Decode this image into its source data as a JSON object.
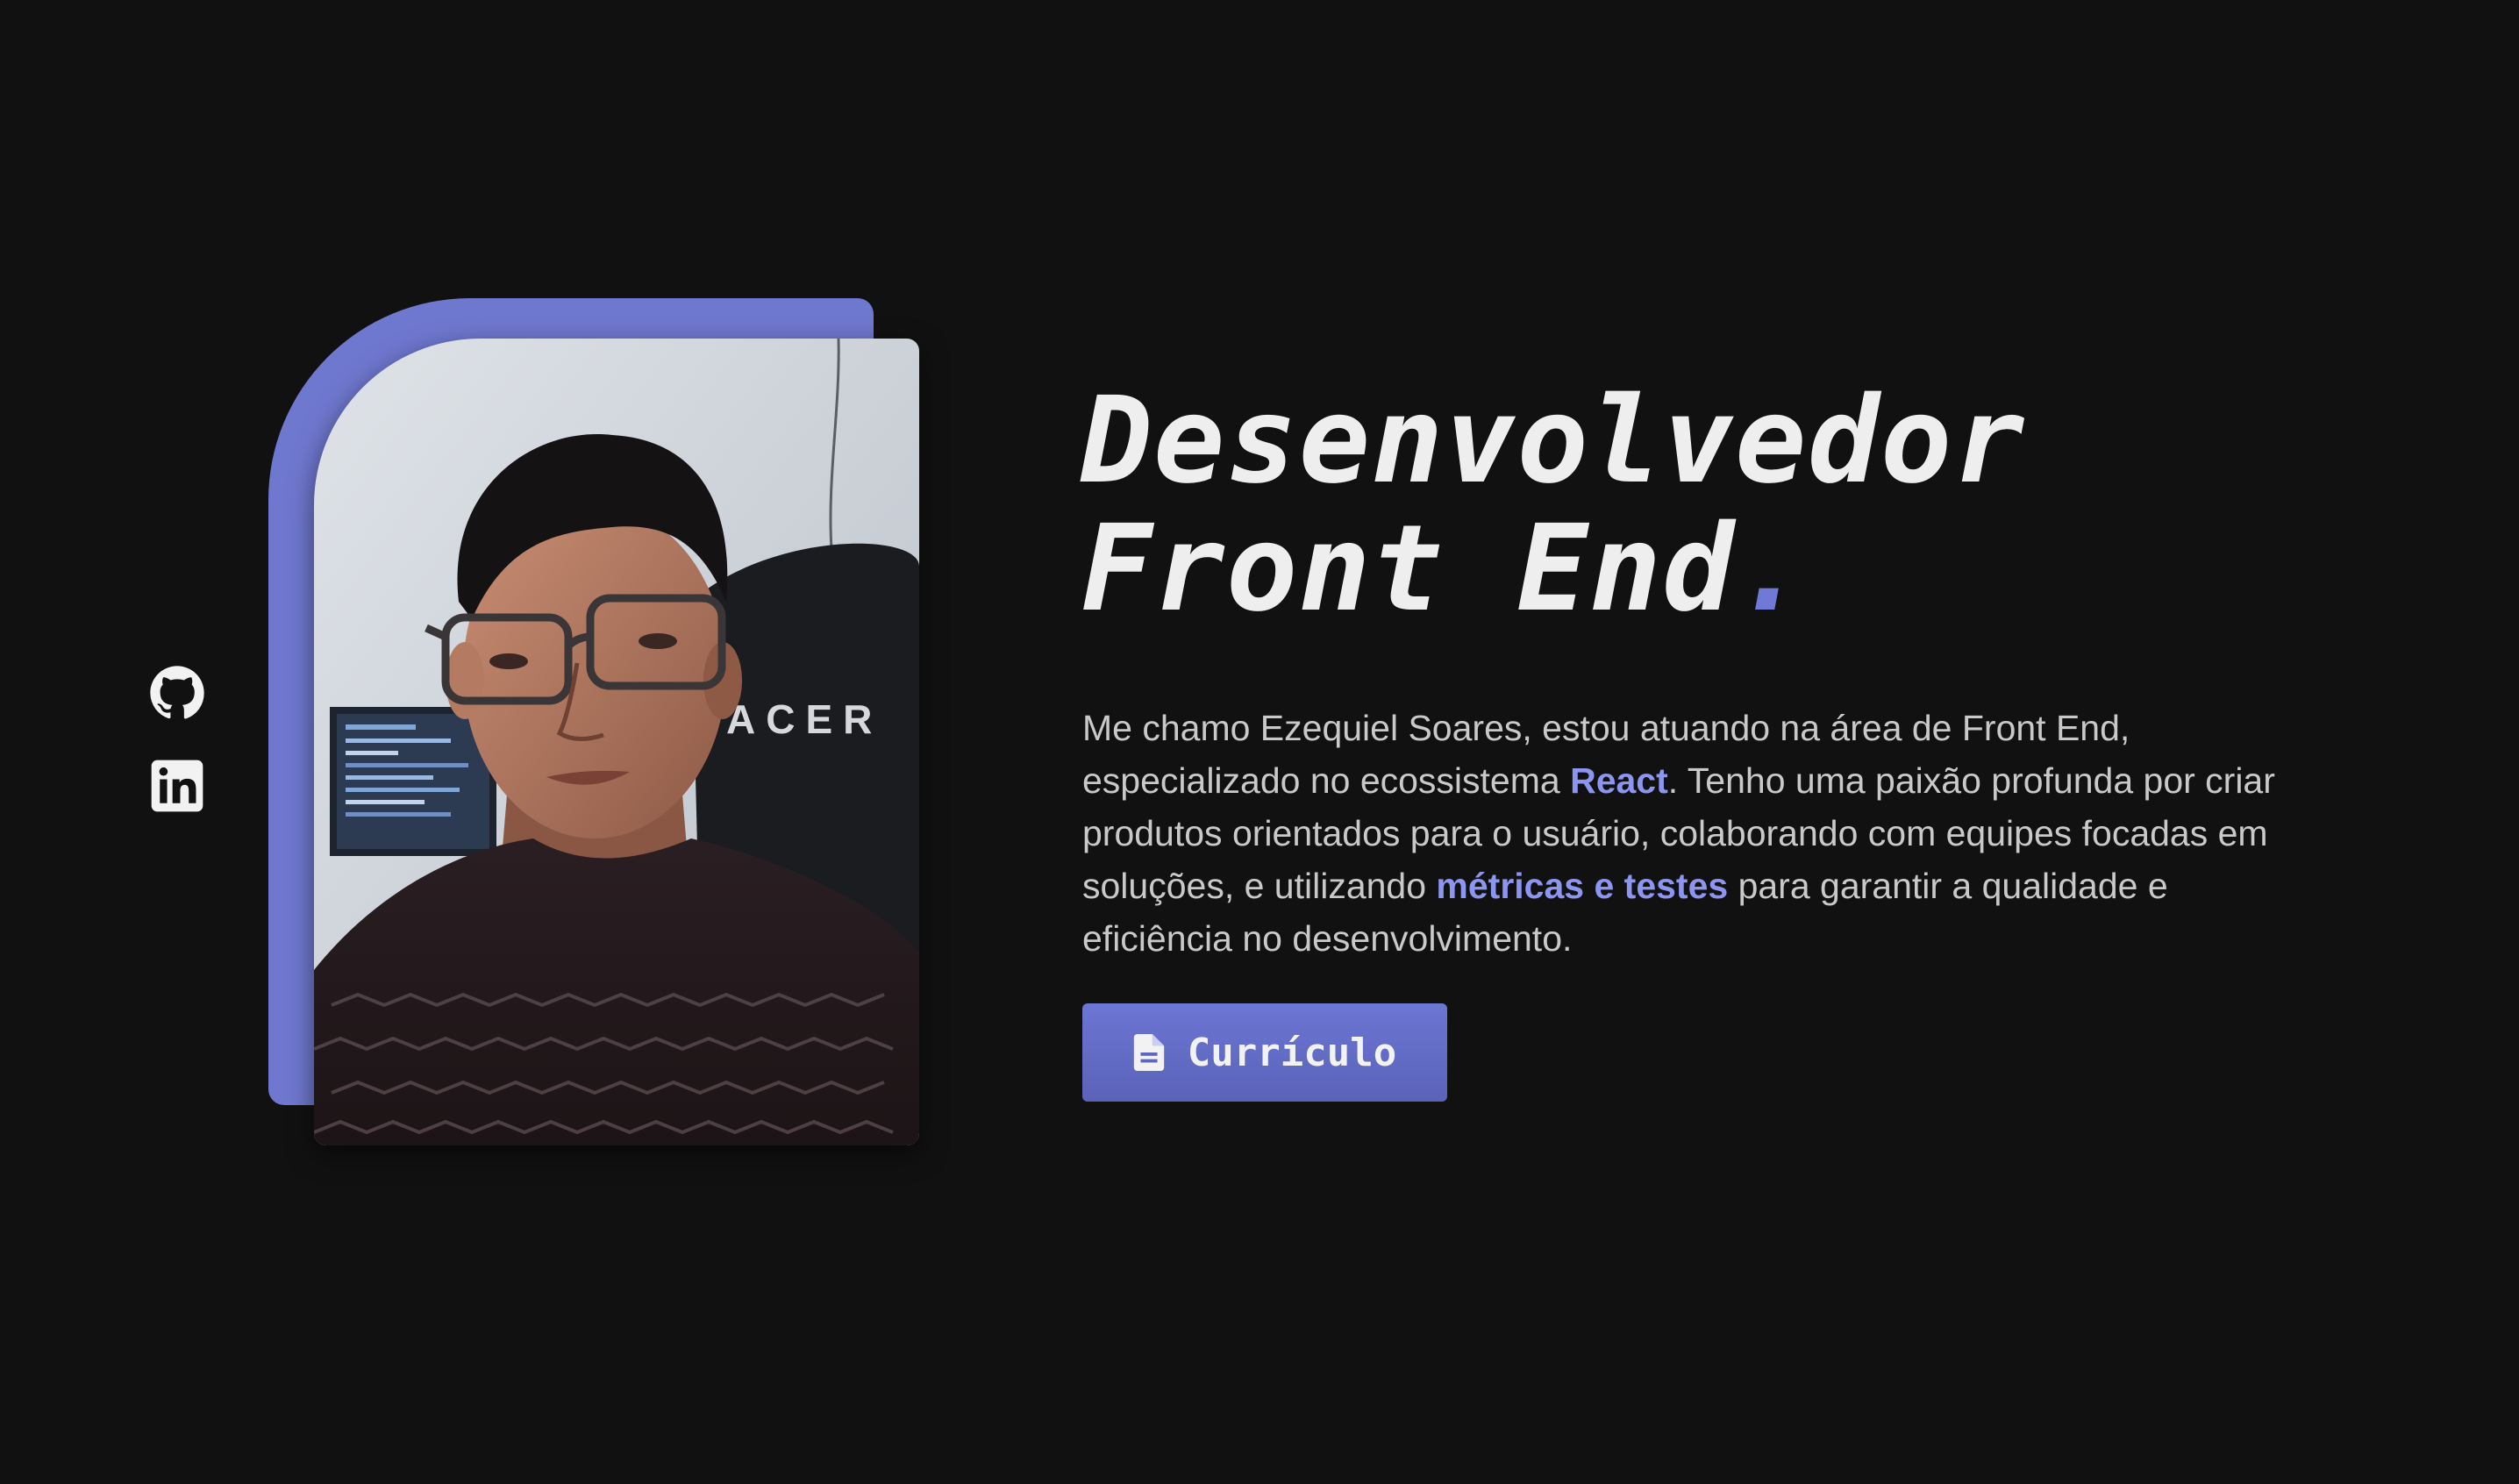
{
  "social": {
    "github_icon": "github-icon",
    "linkedin_icon": "linkedin-icon"
  },
  "profile": {
    "photo": "profile-photo"
  },
  "hero": {
    "title_line1": "Desenvolvedor",
    "title_line2": "Front End",
    "title_dot": ".",
    "description": {
      "part1": "Me chamo Ezequiel Soares, estou atuando na área de Front End, especializado no ecossistema ",
      "highlight1": "React",
      "part2": ". Tenho uma paixão profunda por criar produtos orientados para o usuário, colaborando com equipes focadas em soluções, e utilizando ",
      "highlight2": "métricas e testes",
      "part3": " para garantir a qualidade e eficiência no desenvolvimento."
    },
    "cv_button_label": "Currículo",
    "cv_button_icon": "document-icon"
  },
  "colors": {
    "background": "#111111",
    "accent": "#6f78cf",
    "highlight": "#8c95f0",
    "text": "#eeeeee",
    "muted_text": "#c9c9c9"
  }
}
